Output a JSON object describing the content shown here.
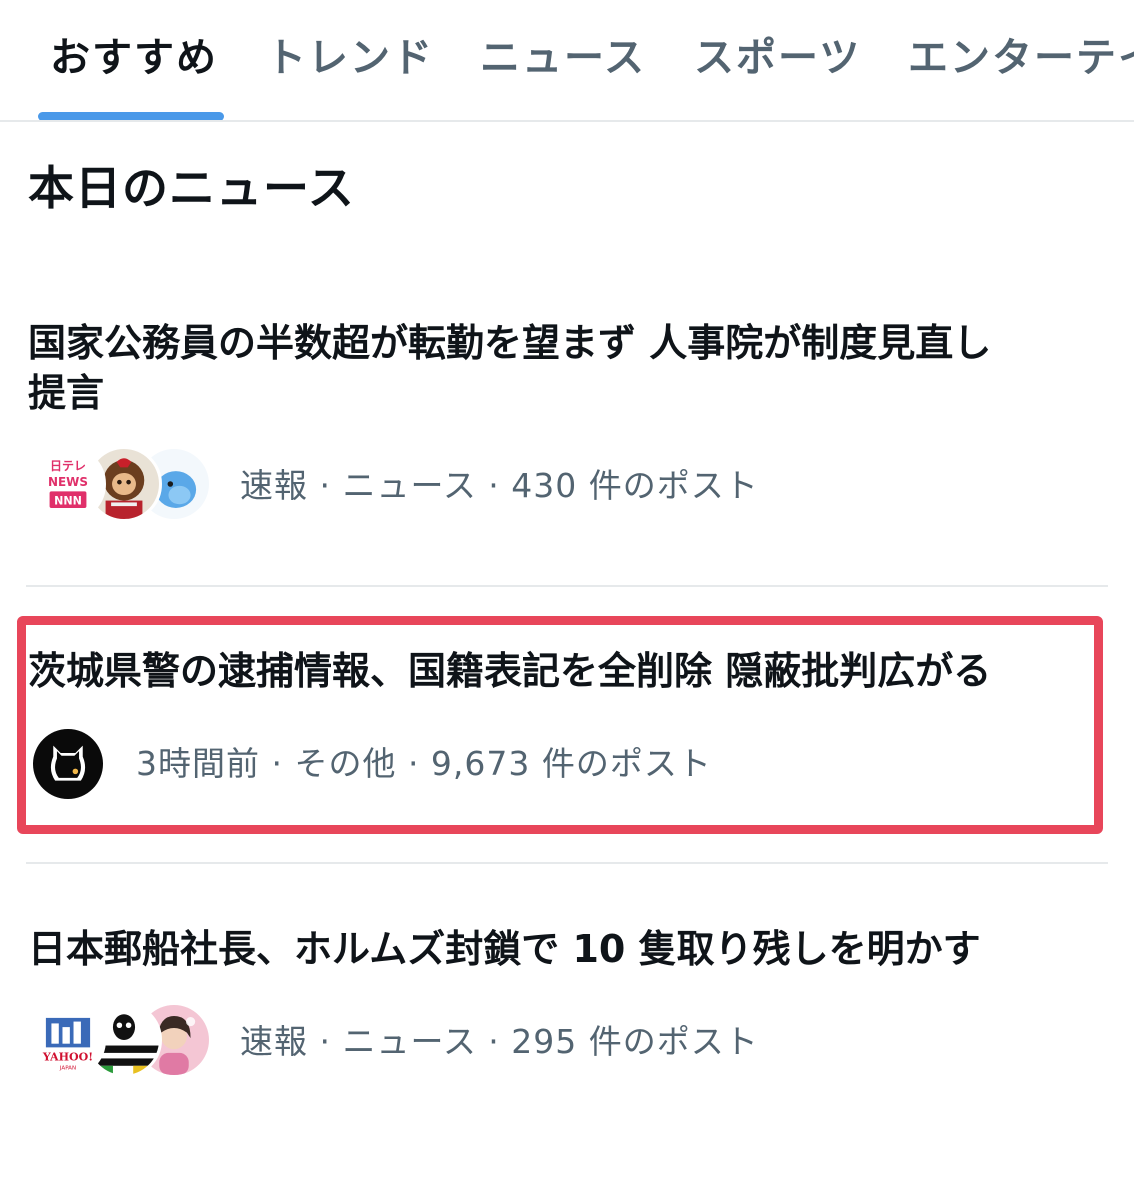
{
  "tabs": [
    {
      "label": "おすすめ",
      "active": true
    },
    {
      "label": "トレンド",
      "active": false
    },
    {
      "label": "ニュース",
      "active": false
    },
    {
      "label": "スポーツ",
      "active": false
    },
    {
      "label": "エンターテイ",
      "active": false
    }
  ],
  "section_title": "本日のニュース",
  "news": [
    {
      "headline_line1": "国家公務員の半数超が転勤を望まず 人事院が制度見直し",
      "headline_line2": "提言",
      "meta": "速報 · ニュース · 430 件のポスト",
      "avatars": [
        "ntv-news-logo-icon",
        "monchhichi-doll-avatar",
        "blue-bird-avatar"
      ],
      "avatar_logo_text": [
        "日テレ",
        "NEWS",
        "NNN"
      ]
    },
    {
      "headline": "茨城県警の逮捕情報、国籍表記を全削除 隠蔽批判広がる",
      "meta": "3時間前 · その他 · 9,673 件のポスト",
      "avatars": [
        "black-cat-avatar"
      ],
      "highlighted": true
    },
    {
      "headline": "日本郵船社長、ホルムズ封鎖で 10 隻取り残しを明かす",
      "meta": "速報 · ニュース · 295 件のポスト",
      "avatars": [
        "yahoo-news-logo-icon",
        "character-avatar",
        "person-photo-avatar"
      ],
      "avatar_logo_text": [
        "YAHOO!",
        "JAPAN"
      ]
    }
  ],
  "colors": {
    "tab_indicator": "#4a99e9",
    "highlight_border": "#e8465a",
    "meta_text": "#536471",
    "primary_text": "#0f1419",
    "divider": "#e6e9eb"
  }
}
